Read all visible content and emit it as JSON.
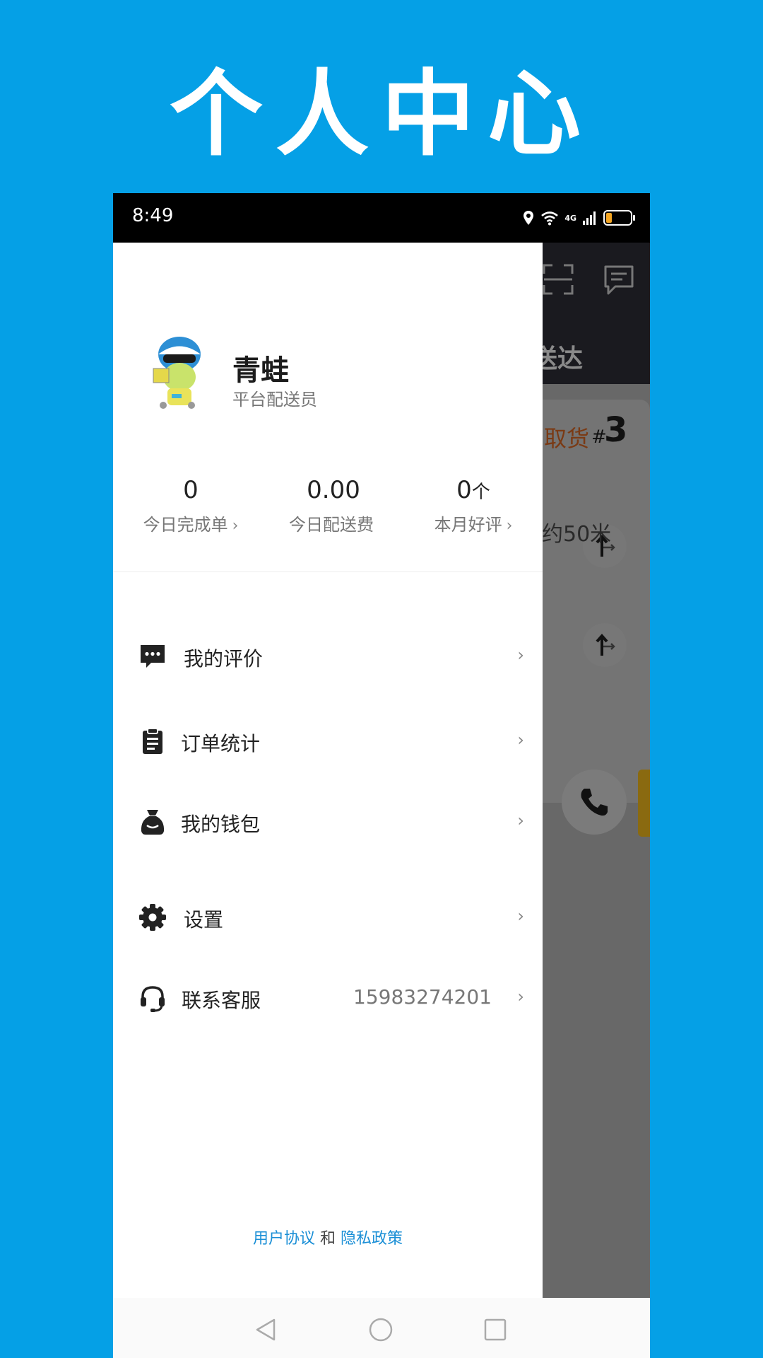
{
  "banner": {
    "title": "个人中心"
  },
  "status_bar": {
    "time": "8:49",
    "network": "4G"
  },
  "background_app": {
    "tab_text": "送达",
    "pickup_text": "取货",
    "pickup_hash": "#",
    "pickup_number": "3",
    "distance_text": "约50米"
  },
  "profile": {
    "name": "青蛙",
    "role": "平台配送员"
  },
  "stats": [
    {
      "value": "0",
      "unit": "",
      "label": "今日完成单",
      "chevron": "›"
    },
    {
      "value": "0.00",
      "unit": "",
      "label": "今日配送费",
      "chevron": ""
    },
    {
      "value": "0",
      "unit": "个",
      "label": "本月好评",
      "chevron": "›"
    }
  ],
  "menu": [
    {
      "label": "我的评价",
      "value": "",
      "icon": "chat-dots-icon"
    },
    {
      "label": "订单统计",
      "value": "",
      "icon": "clipboard-icon"
    },
    {
      "label": "我的钱包",
      "value": "",
      "icon": "wallet-bag-icon"
    },
    {
      "label": "设置",
      "value": "",
      "icon": "gear-icon"
    },
    {
      "label": "联系客服",
      "value": "15983274201",
      "icon": "headset-icon"
    }
  ],
  "menu_chevron": "›",
  "legal": {
    "user_agreement": "用户协议",
    "and": "和",
    "privacy_policy": "隐私政策"
  },
  "colors": {
    "banner_bg": "#05A0E6",
    "link": "#1B8FD6",
    "status_bar": "#000000"
  }
}
